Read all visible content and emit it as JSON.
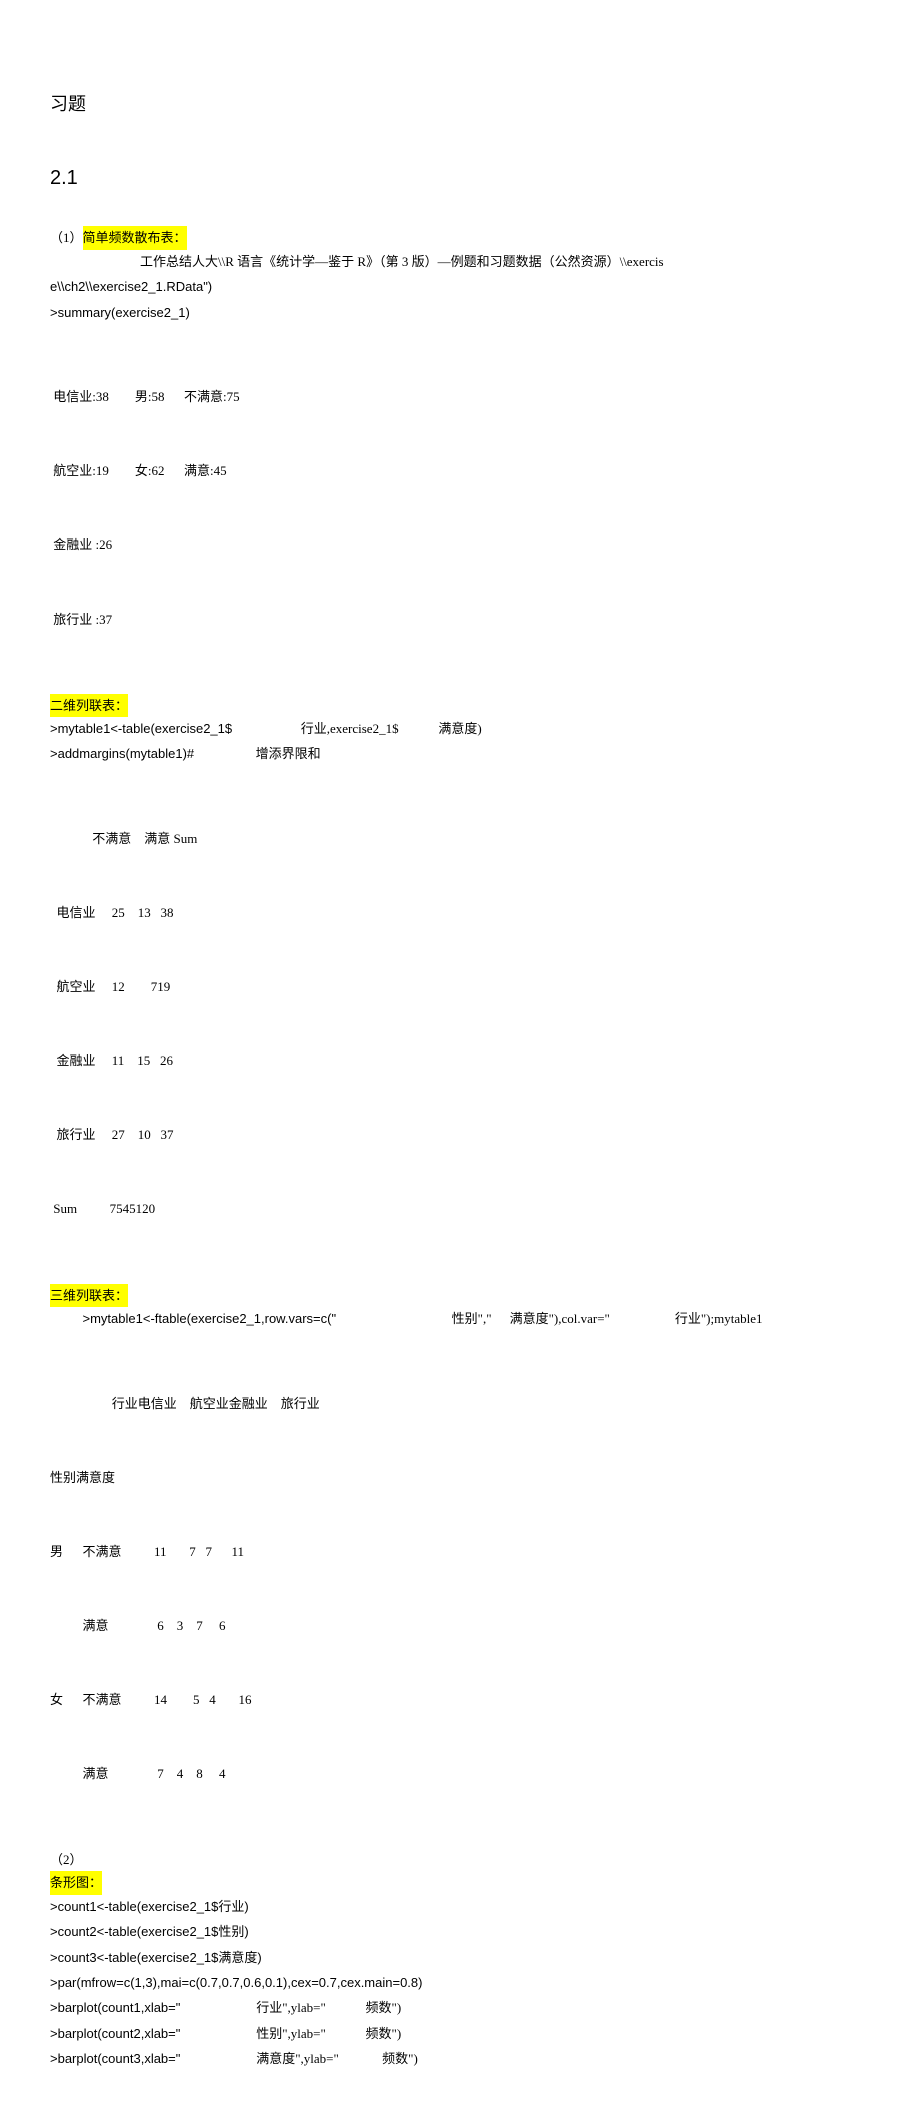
{
  "page_title": "习题",
  "section_number": "2.1",
  "s1": {
    "label_prefix": "（1）",
    "label_text": "简单频数散布表：",
    "path_line": "工作总结人大\\\\R 语言《统计学—鉴于 R》（第 3 版）—例题和习题数据（公然资源）\\\\exercis",
    "path_line2": "e\\\\ch2\\\\exercise2_1.RData\")",
    "summary_cmd": ">summary(exercise2_1)",
    "summary_rows": [
      " 电信业:38        男:58      不满意:75",
      " 航空业:19        女:62      满意:45",
      " 金融业 :26",
      " 旅行业 :37"
    ]
  },
  "s2": {
    "label": "二维列联表：",
    "cmd1a": ">mytable1<-table(exercise2_1$",
    "cmd1b": "行业,exercise2_1$",
    "cmd1c": "满意度)",
    "cmd2a": ">addmargins(mytable1)#",
    "cmd2b": "增添界限和",
    "table_rows": [
      "             不满意    满意 Sum",
      "  电信业     25    13   38",
      "  航空业     12        719",
      "  金融业     11    15   26",
      "  旅行业     27    10   37",
      " Sum          7545120"
    ]
  },
  "s3": {
    "label": "三维列联表：",
    "cmd_parts": {
      "a": ">mytable1<-ftable(exercise2_1,row.vars=c(\"",
      "b": "性别\",\"",
      "c": "满意度\"),col.var=\"",
      "d": "行业\");mytable1"
    },
    "header_line": "                   行业电信业    航空业金融业    旅行业",
    "label_line": "性别满意度",
    "rows": [
      "男      不满意          11       7   7      11",
      "          满意               6    3    7     6",
      "女      不满意          14        5   4       16",
      "          满意               7    4    8     4"
    ]
  },
  "s4": {
    "label_prefix": "（2）",
    "label_text": "条形图：",
    "lines": [
      ">count1<-table(exercise2_1$行业)",
      ">count2<-table(exercise2_1$性别)",
      ">count3<-table(exercise2_1$满意度)",
      ">par(mfrow=c(1,3),mai=c(0.7,0.7,0.6,0.1),cex=0.7,cex.main=0.8)"
    ],
    "barplot_lines": [
      {
        "pre": ">barplot(count1,xlab=\"",
        "mid": "行业\",ylab=\"",
        "end": "频数\")"
      },
      {
        "pre": ">barplot(count2,xlab=\"",
        "mid": "性别\",ylab=\"",
        "end": "频数\")"
      },
      {
        "pre": ">barplot(count3,xlab=\"",
        "mid": "满意度\",ylab=\"",
        "end": "频数\")"
      }
    ]
  }
}
